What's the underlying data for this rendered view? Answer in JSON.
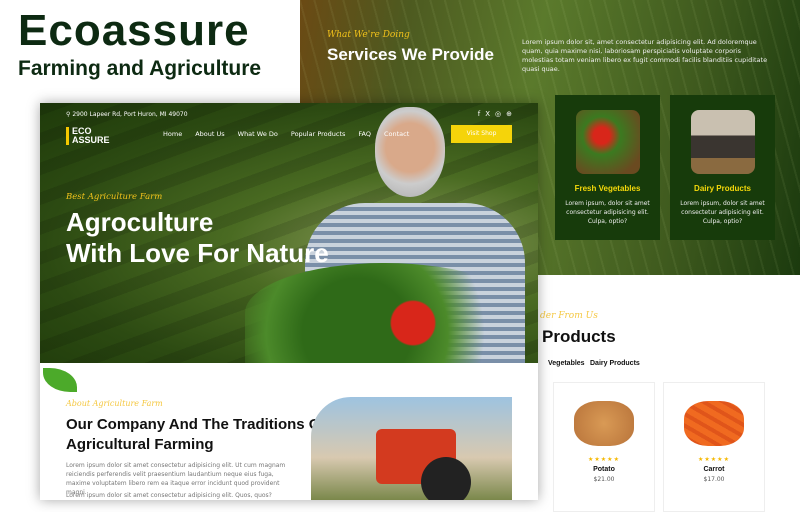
{
  "promo": {
    "title": "Ecoassure",
    "subtitle": "Farming and Agriculture"
  },
  "services": {
    "kicker": "What We're Doing",
    "title": "Services We Provide",
    "text": "Lorem ipsum dolor sit, amet consectetur adipisicing elit. Ad doloremque quam, quia maxime nisi, laboriosam perspiciatis voluptate corporis molestias totam veniam libero ex fugit commodi facilis blanditiis cupiditate quasi quae.",
    "cards": [
      {
        "title": "Fresh Vegetables",
        "text": "Lorem ipsum, dolor sit amet consectetur adipisicing elit. Culpa, optio?"
      },
      {
        "title": "Dairy Products",
        "text": "Lorem ipsum, dolor sit amet consectetur adipisicing elit. Culpa, optio?"
      }
    ]
  },
  "products": {
    "kicker": "der From Us",
    "title": "Products",
    "tabs": [
      "Vegetables",
      "Dairy Products"
    ],
    "items": [
      {
        "name": "Potato",
        "price": "$21.00",
        "rating": "★★★★★"
      },
      {
        "name": "Carrot",
        "price": "$17.00",
        "rating": "★★★★★"
      }
    ]
  },
  "header": {
    "address": "2900 Lapeer Rd, Port Huron, MI 49070",
    "social": [
      "f",
      "X",
      "◎",
      "⊕"
    ],
    "logo": [
      "ECO",
      "ASSURE"
    ],
    "nav": [
      "Home",
      "About Us",
      "What We Do",
      "Popular Products",
      "FAQ",
      "Contact"
    ],
    "cta": "Visit Shop"
  },
  "hero": {
    "kicker": "Best Agriculture Farm",
    "title1": "Agroculture",
    "title2": "With Love For Nature"
  },
  "about": {
    "kicker": "About Agriculture Farm",
    "title": "Our Company And The Traditions Of Agricultural Farming",
    "p1": "Lorem ipsum dolor sit amet consectetur adipisicing elit. Ut cum magnam reiciendis perferendis velit praesentium laudantium neque eius fuga, maxime voluptatem libero rem ea itaque error incidunt quod provident magni.",
    "p2": "Lorem ipsum dolor sit amet consectetur adipisicing elit. Quos, quos?"
  }
}
